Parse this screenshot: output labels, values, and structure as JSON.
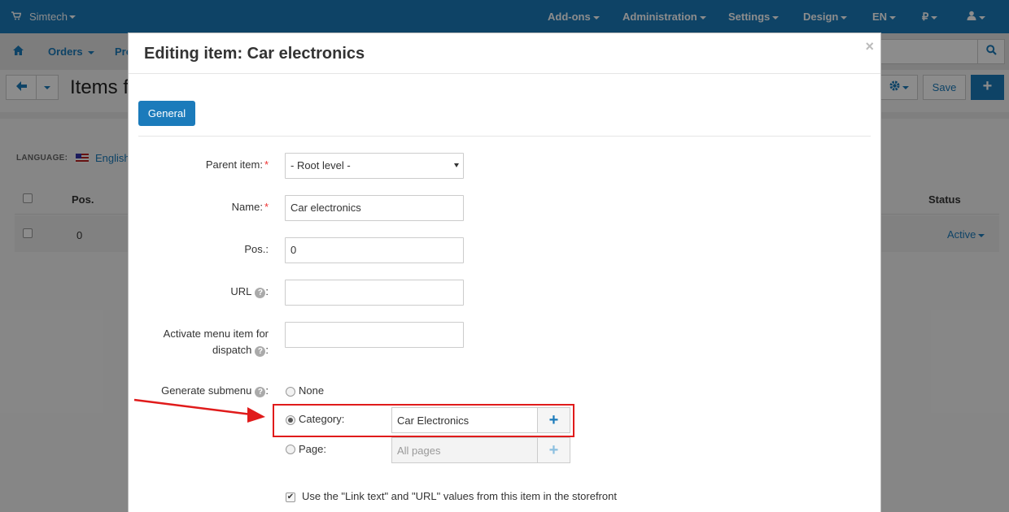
{
  "topbar": {
    "brand": "Simtech",
    "menu": [
      "Add-ons",
      "Administration",
      "Settings",
      "Design",
      "EN",
      "₽"
    ]
  },
  "subbar": {
    "orders": "Orders",
    "products_partial": "Pro"
  },
  "titlebar": {
    "title_partial": "Items f",
    "save": "Save"
  },
  "page": {
    "language_label": "LANGUAGE:",
    "language_value": "English",
    "col_pos": "Pos.",
    "col_status": "Status",
    "row_pos": "0",
    "row_status": "Active"
  },
  "modal": {
    "title": "Editing item: Car electronics",
    "tab_general": "General",
    "fields": {
      "parent_label": "Parent item:",
      "parent_value": "- Root level -",
      "name_label": "Name:",
      "name_value": "Car electronics",
      "pos_label": "Pos.:",
      "pos_value": "0",
      "url_label": "URL",
      "url_value": "",
      "dispatch_label_line1": "Activate menu item for",
      "dispatch_label_line2": "dispatch",
      "dispatch_value": "",
      "submenu_label": "Generate submenu"
    },
    "submenu_options": {
      "none": "None",
      "category": "Category:",
      "category_value": "Car Electronics",
      "page": "Page:",
      "page_value": "All pages"
    },
    "use_link_text_label": "Use the \"Link text\" and \"URL\" values from this item in the storefront"
  },
  "colors": {
    "primary": "#1b7bbb",
    "highlight": "#e01b1b",
    "required": "#e33333"
  }
}
